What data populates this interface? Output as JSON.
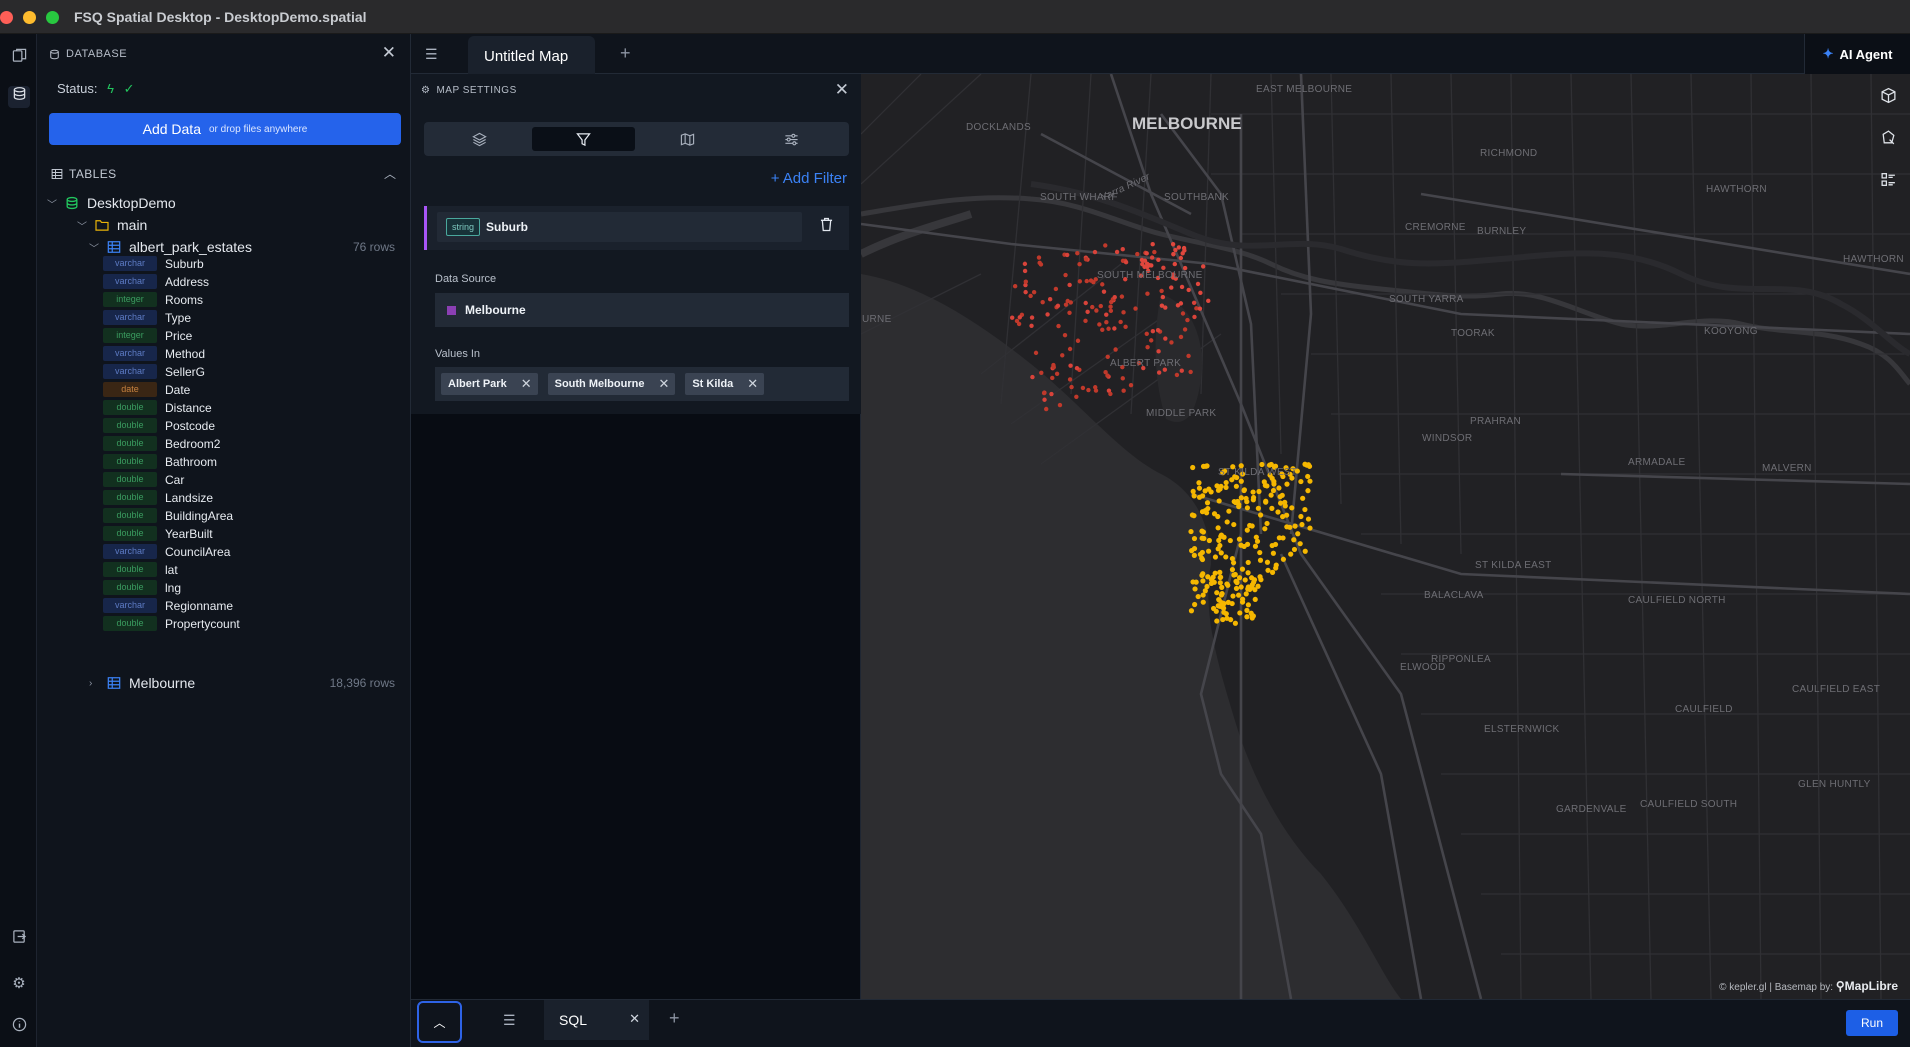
{
  "window": {
    "title": "FSQ Spatial Desktop - DesktopDemo.spatial"
  },
  "database": {
    "header": "DATABASE",
    "status_label": "Status:",
    "add_data_label": "Add Data",
    "add_data_hint": "or drop files anywhere",
    "tables_header": "TABLES",
    "db_name": "DesktopDemo",
    "schema": "main",
    "tables": [
      {
        "name": "albert_park_estates",
        "rows": "76 rows"
      },
      {
        "name": "Melbourne",
        "rows": "18,396 rows"
      }
    ],
    "columns": [
      {
        "type": "varchar",
        "name": "Suburb"
      },
      {
        "type": "varchar",
        "name": "Address"
      },
      {
        "type": "integer",
        "name": "Rooms"
      },
      {
        "type": "varchar",
        "name": "Type"
      },
      {
        "type": "integer",
        "name": "Price"
      },
      {
        "type": "varchar",
        "name": "Method"
      },
      {
        "type": "varchar",
        "name": "SellerG"
      },
      {
        "type": "date",
        "name": "Date"
      },
      {
        "type": "double",
        "name": "Distance"
      },
      {
        "type": "double",
        "name": "Postcode"
      },
      {
        "type": "double",
        "name": "Bedroom2"
      },
      {
        "type": "double",
        "name": "Bathroom"
      },
      {
        "type": "double",
        "name": "Car"
      },
      {
        "type": "double",
        "name": "Landsize"
      },
      {
        "type": "double",
        "name": "BuildingArea"
      },
      {
        "type": "double",
        "name": "YearBuilt"
      },
      {
        "type": "varchar",
        "name": "CouncilArea"
      },
      {
        "type": "double",
        "name": "lat"
      },
      {
        "type": "double",
        "name": "lng"
      },
      {
        "type": "varchar",
        "name": "Regionname"
      },
      {
        "type": "double",
        "name": "Propertycount"
      }
    ]
  },
  "tabs": {
    "map_tab": "Untitled Map",
    "ai_agent": "AI Agent"
  },
  "map_settings": {
    "header": "MAP SETTINGS",
    "add_filter": "+ Add Filter",
    "filter": {
      "type_tag": "string",
      "field": "Suburb"
    },
    "data_source_label": "Data Source",
    "data_source": "Melbourne",
    "data_source_color": "#8b3fb3",
    "values_label": "Values In",
    "values": [
      "Albert Park",
      "South Melbourne",
      "St Kilda"
    ]
  },
  "map": {
    "city_label": "MELBOURNE",
    "place_labels": [
      "DOCKLANDS",
      "EAST MELBOURNE",
      "RICHMOND",
      "HAWTHORN",
      "CREMORNE",
      "BURNLEY",
      "SOUTH WHARF",
      "SOUTHBANK",
      "SOUTH MELBOURNE",
      "SOUTH YARRA",
      "TOORAK",
      "KOOYONG",
      "ALBERT PARK",
      "MIDDLE PARK",
      "PRAHRAN",
      "WINDSOR",
      "ARMADALE",
      "MALVERN",
      "ST KILDA WEST",
      "ST KILDA EAST",
      "BALACLAVA",
      "CAULFIELD NORTH",
      "RIPPONLEA",
      "ELWOOD",
      "CAULFIELD EAST",
      "CAULFIELD",
      "ELSTERNWICK",
      "GLEN HUNTLY",
      "CAULFIELD SOUTH",
      "GARDENVALE",
      "Yarra River",
      "HAWTHORN",
      "URNE"
    ],
    "credit": "© kepler.gl | Basemap by:",
    "credit_brand": "MapLibre",
    "colors": {
      "red_points": "#c0392b",
      "yellow_points": "#f5b700"
    }
  },
  "bottom": {
    "sql_tab": "SQL",
    "run": "Run"
  }
}
